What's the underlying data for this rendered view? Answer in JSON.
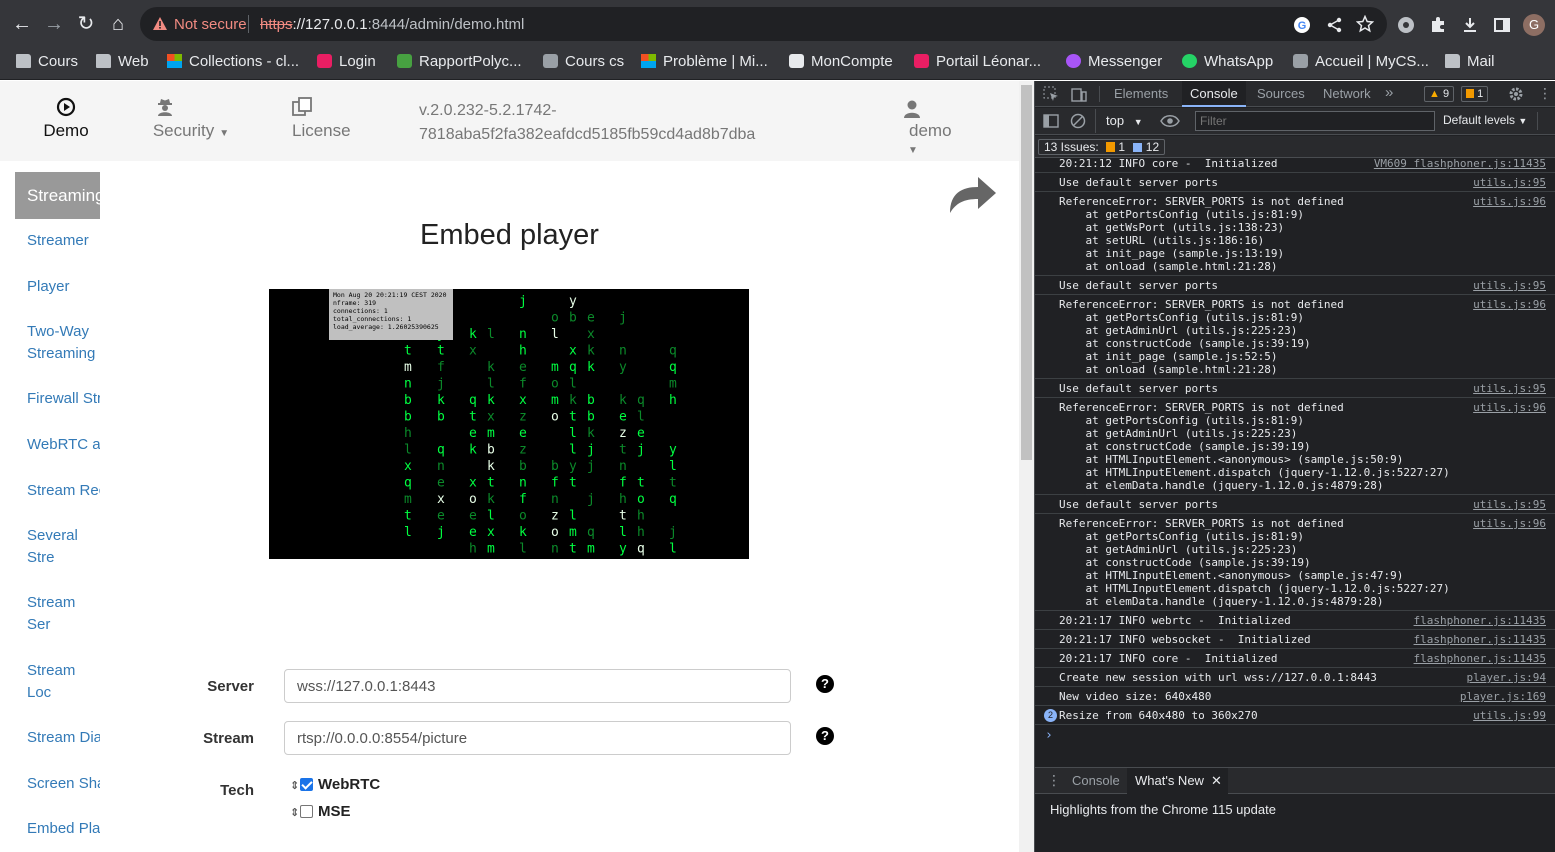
{
  "browser": {
    "security_status": "Not secure",
    "url_protocol": "https",
    "url_host": "://127.0.0.1",
    "url_rest": ":8444/admin/demo.html"
  },
  "bookmarks": [
    {
      "label": "Cours",
      "icon": "folder-icon"
    },
    {
      "label": "Web",
      "icon": "folder-icon"
    },
    {
      "label": "Collections - cl...",
      "icon": "microsoft-icon"
    },
    {
      "label": "Login",
      "icon": "login-icon"
    },
    {
      "label": "RapportPolyc...",
      "icon": "overleaf-icon"
    },
    {
      "label": "Cours cs",
      "icon": "cs-icon"
    },
    {
      "label": "Problème | Mi...",
      "icon": "microsoft-icon"
    },
    {
      "label": "MonCompte",
      "icon": "moncompte-icon"
    },
    {
      "label": "Portail Léonar...",
      "icon": "portail-icon"
    },
    {
      "label": "Messenger",
      "icon": "messenger-icon"
    },
    {
      "label": "WhatsApp",
      "icon": "whatsapp-icon"
    },
    {
      "label": "Accueil | MyCS...",
      "icon": "mycs-icon"
    },
    {
      "label": "Mail",
      "icon": "folder-icon"
    }
  ],
  "nav": {
    "demo": "Demo",
    "security": "Security",
    "license": "License",
    "version_line1": "v.2.0.232-5.2.1742-",
    "version_line2": "7818aba5f2fa382eafdcd5185fb59cd4ad8b7dba",
    "user": "demo"
  },
  "sidebar": {
    "active": "Streaming",
    "items": [
      "Streamer",
      "Player",
      "Two-Way Streaming",
      "Firewall Str",
      "WebRTC as",
      "Stream Rec",
      "Several Stre Recording",
      "Stream Ser Snapshot",
      "Stream Loc Snapshot",
      "Stream Dia",
      "Screen Sha",
      "Embed Play"
    ]
  },
  "main": {
    "title": "Embed player",
    "overlay_line1": "Mon Aug 20 20:21:19 CEST 2020",
    "overlay_line2": "nframe: 319",
    "overlay_line3": "connections: 1",
    "overlay_line4": "total_connections: 1",
    "overlay_line5": "load_average: 1.26025390625",
    "server_label": "Server",
    "server_value": "wss://127.0.0.1:8443",
    "stream_label": "Stream",
    "stream_value": "rtsp://0.0.0.0:8554/picture",
    "tech_label": "Tech",
    "tech_webrtc": "WebRTC",
    "tech_mse": "MSE",
    "help_symbol": "?"
  },
  "devtools": {
    "tabs": [
      "Elements",
      "Console",
      "Sources",
      "Network"
    ],
    "warnings_count": "9",
    "errors_count": "1",
    "context": "top",
    "filter_placeholder": "Filter",
    "levels": "Default levels",
    "issues_label": "13 Issues:",
    "issues_warn": "1",
    "issues_info": "12",
    "drawer_console": "Console",
    "drawer_whatsnew": "What's New",
    "drawer_text": "Highlights from the Chrome 115 update"
  },
  "console_logs": [
    {
      "msg": "20:21:12 INFO core -  Initialized",
      "src": "VM609 flashphoner.js:11435"
    },
    {
      "msg": "Use default server ports",
      "src": "utils.js:95"
    },
    {
      "msg": "ReferenceError: SERVER_PORTS is not defined",
      "src": "utils.js:96",
      "stack": "    at getPortsConfig (utils.js:81:9)\n    at getWsPort (utils.js:138:23)\n    at setURL (utils.js:186:16)\n    at init_page (sample.js:13:19)\n    at onload (sample.html:21:28)"
    },
    {
      "msg": "Use default server ports",
      "src": "utils.js:95"
    },
    {
      "msg": "ReferenceError: SERVER_PORTS is not defined",
      "src": "utils.js:96",
      "stack": "    at getPortsConfig (utils.js:81:9)\n    at getAdminUrl (utils.js:225:23)\n    at constructCode (sample.js:39:19)\n    at init_page (sample.js:52:5)\n    at onload (sample.html:21:28)"
    },
    {
      "msg": "Use default server ports",
      "src": "utils.js:95"
    },
    {
      "msg": "ReferenceError: SERVER_PORTS is not defined",
      "src": "utils.js:96",
      "stack": "    at getPortsConfig (utils.js:81:9)\n    at getAdminUrl (utils.js:225:23)\n    at constructCode (sample.js:39:19)\n    at HTMLInputElement.<anonymous> (sample.js:50:9)\n    at HTMLInputElement.dispatch (jquery-1.12.0.js:5227:27)\n    at elemData.handle (jquery-1.12.0.js:4879:28)"
    },
    {
      "msg": "Use default server ports",
      "src": "utils.js:95"
    },
    {
      "msg": "ReferenceError: SERVER_PORTS is not defined",
      "src": "utils.js:96",
      "stack": "    at getPortsConfig (utils.js:81:9)\n    at getAdminUrl (utils.js:225:23)\n    at constructCode (sample.js:39:19)\n    at HTMLInputElement.<anonymous> (sample.js:47:9)\n    at HTMLInputElement.dispatch (jquery-1.12.0.js:5227:27)\n    at elemData.handle (jquery-1.12.0.js:4879:28)"
    },
    {
      "msg": "20:21:17 INFO webrtc -  Initialized",
      "src": "flashphoner.js:11435"
    },
    {
      "msg": "20:21:17 INFO websocket -  Initialized",
      "src": "flashphoner.js:11435"
    },
    {
      "msg": "20:21:17 INFO core -  Initialized",
      "src": "flashphoner.js:11435"
    },
    {
      "msg": "Create new session with url wss://127.0.0.1:8443",
      "src": "player.js:94"
    },
    {
      "msg": "New video size: 640x480",
      "src": "player.js:169"
    },
    {
      "msg": "Resize from 640x480 to 360x270",
      "src": "utils.js:99",
      "count": "2"
    }
  ],
  "colors": {
    "link": "#337ab7",
    "matrix_green": "#00ff41",
    "devtools_bg": "#202124"
  }
}
